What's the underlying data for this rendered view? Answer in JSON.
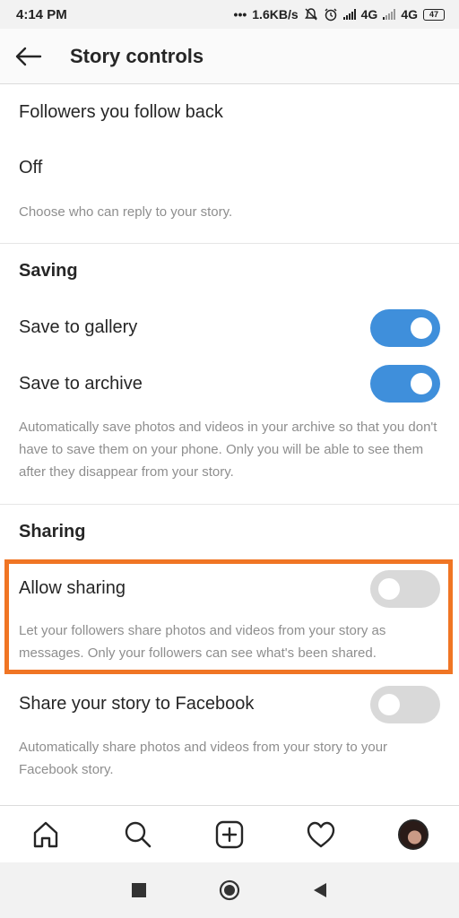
{
  "status_bar": {
    "time": "4:14 PM",
    "dots": "•••",
    "speed": "1.6KB/s",
    "network1": "4G",
    "network2": "4G",
    "battery": "47"
  },
  "header": {
    "title": "Story controls"
  },
  "reply": {
    "option": "Followers you follow back",
    "off": "Off",
    "description": "Choose who can reply to your story."
  },
  "saving": {
    "title": "Saving",
    "save_to_gallery": {
      "label": "Save to gallery",
      "on": true
    },
    "save_to_archive": {
      "label": "Save to archive",
      "on": true
    },
    "description": "Automatically save photos and videos in your archive so that you don't have to save them on your phone. Only you will be able to see them after they disappear from your story."
  },
  "sharing": {
    "title": "Sharing",
    "allow_sharing": {
      "label": "Allow sharing",
      "on": false,
      "description": "Let your followers share photos and videos from your story as messages. Only your followers can see what's been shared."
    },
    "share_to_facebook": {
      "label": "Share your story to Facebook",
      "on": false,
      "description": "Automatically share photos and videos from your story to your Facebook story."
    }
  },
  "highlight_color": "#f07524",
  "toggle_on_color": "#3f8fdb",
  "tabbar": {
    "items": [
      "home-icon",
      "search-icon",
      "add-post-icon",
      "heart-icon",
      "profile-avatar"
    ]
  },
  "navbar": {
    "items": [
      "recent-apps-icon",
      "home-button-icon",
      "back-icon"
    ]
  }
}
